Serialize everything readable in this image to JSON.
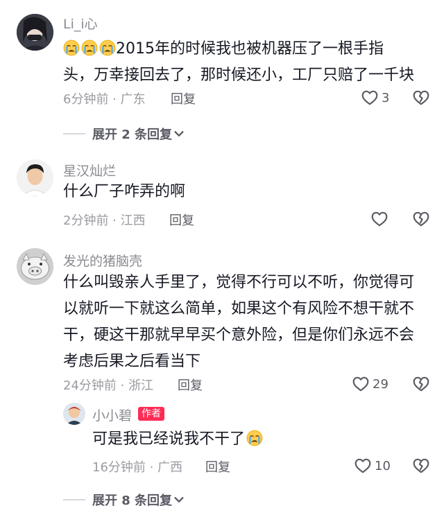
{
  "comments": [
    {
      "username": "Li_i心",
      "text_line1": "2015年的时候我也被机器压了一根手指",
      "text_line2": "头，万幸接回去了，那时候还小，工厂只赔了一千块",
      "emoji": "crying-face-icon",
      "time_location": "6分钟前 · 广东",
      "reply_label": "回复",
      "likes": "3",
      "expand_label": "展开 2 条回复"
    },
    {
      "username": "星汉灿烂",
      "text": "什么厂子咋弄的啊",
      "time_location": "2分钟前 · 江西",
      "reply_label": "回复",
      "likes": ""
    },
    {
      "username": "发光的猪脑壳",
      "text_lines": [
        "什么叫毁亲人手里了，觉得不行可以不听，你觉得可",
        "以就听一下就这么简单，如果这个有风险不想干就不",
        "干，硬这干那就早早买个意外险，但是你们永远不会",
        "考虑后果之后看当下"
      ],
      "time_location": "24分钟前 · 浙江",
      "reply_label": "回复",
      "likes": "29",
      "reply": {
        "username": "小小碧",
        "author_badge": "作者",
        "text": "可是我已经说我不干了",
        "time_location": "16分钟前 · 广西",
        "reply_label": "回复",
        "likes": "10"
      },
      "expand_label": "展开 8 条回复"
    }
  ],
  "colors": {
    "text": "#161823",
    "meta": "#9a9ba1",
    "badge": "#fe2c55"
  }
}
